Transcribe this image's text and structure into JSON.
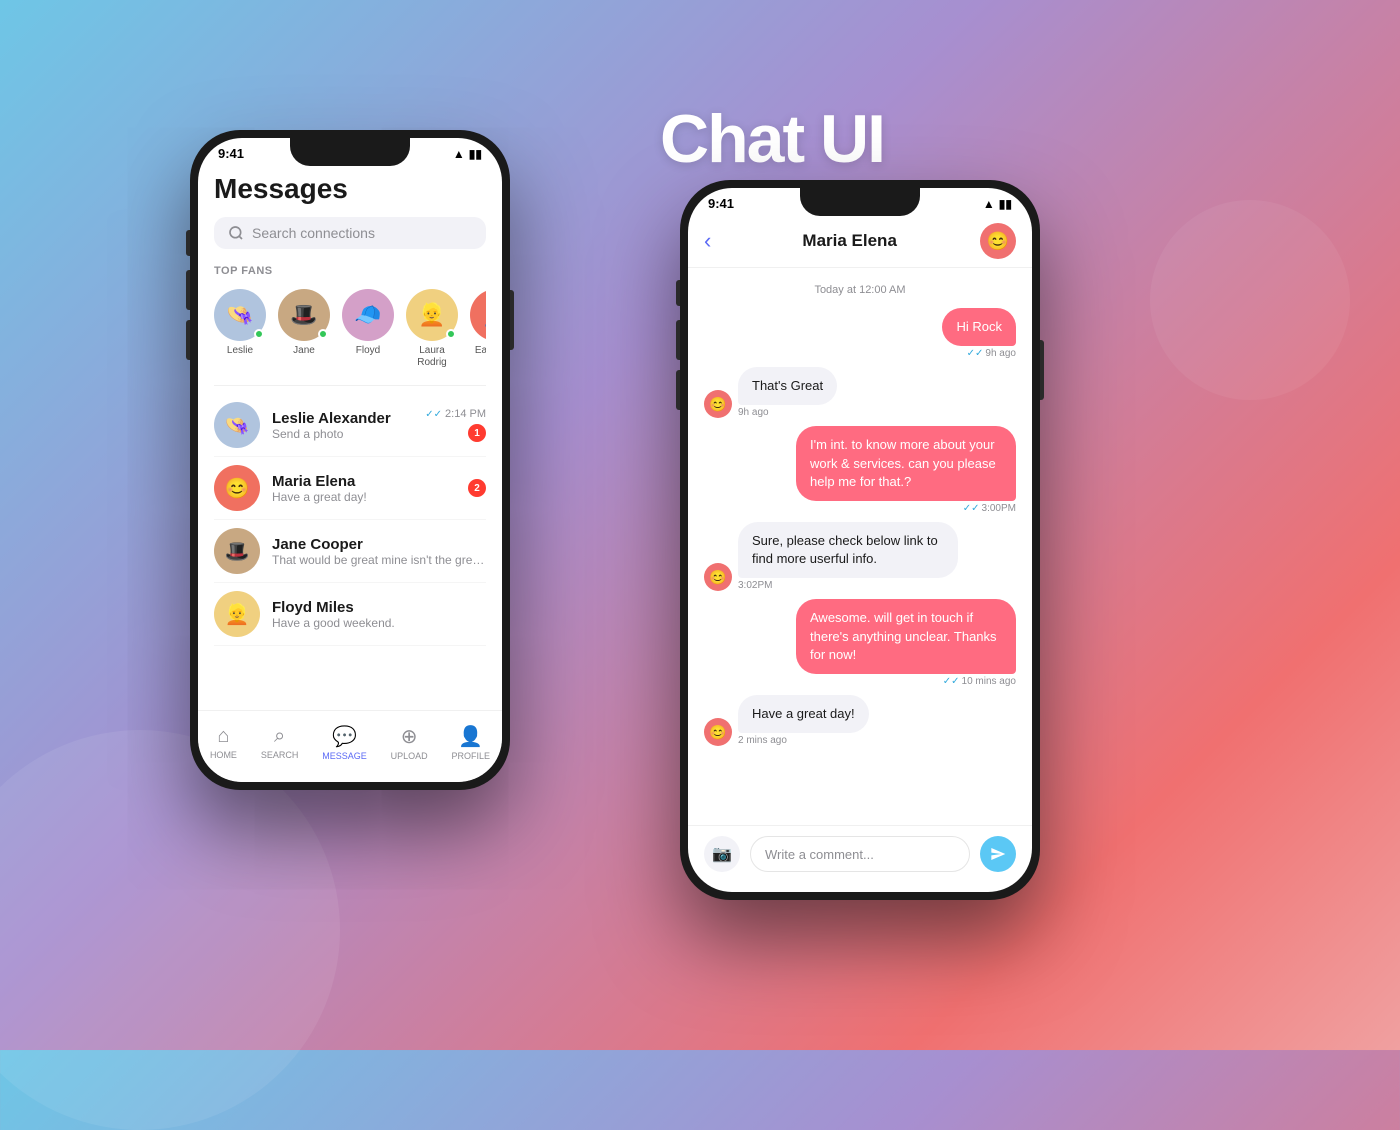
{
  "background": {
    "gradient": "linear-gradient(135deg, #6ec6e6 0%, #a78fd0 40%, #f07070 80%, #f0a0a0 100%)"
  },
  "title": "Chat UI",
  "left_phone": {
    "status_bar": {
      "time": "9:41",
      "wifi": "wifi",
      "battery": "battery"
    },
    "screen_title": "Messages",
    "search_placeholder": "Search connections",
    "section_label": "TOP FANS",
    "fans": [
      {
        "name": "Leslie",
        "emoji": "👒",
        "bg": "#b0c4de",
        "online": true
      },
      {
        "name": "Jane",
        "emoji": "🎩",
        "bg": "#c8a882",
        "online": true
      },
      {
        "name": "Floyd",
        "emoji": "🧢",
        "bg": "#d4a0c8",
        "online": false
      },
      {
        "name": "Laura Rodrig",
        "emoji": "👱",
        "bg": "#f0d080",
        "online": true
      },
      {
        "name": "Earl Mald",
        "emoji": "👤",
        "bg": "#f07060",
        "online": false
      }
    ],
    "conversations": [
      {
        "name": "Leslie Alexander",
        "preview": "Send a photo",
        "time": "2:14 PM",
        "badge": "1",
        "emoji": "👒",
        "bg": "#b0c4de",
        "double_check": true
      },
      {
        "name": "Maria Elena",
        "preview": "Have a great day!",
        "time": "",
        "badge": "2",
        "emoji": "😊",
        "bg": "#f07060",
        "double_check": false
      },
      {
        "name": "Jane Cooper",
        "preview": "That would be great mine isn't the great...",
        "time": "",
        "badge": "",
        "emoji": "🎩",
        "bg": "#c8a882",
        "double_check": false
      },
      {
        "name": "Floyd Miles",
        "preview": "Have a good weekend.",
        "time": "",
        "badge": "",
        "emoji": "👱",
        "bg": "#f0d080",
        "double_check": false
      }
    ],
    "nav_items": [
      {
        "label": "HOME",
        "icon": "⌂",
        "active": false
      },
      {
        "label": "SEARCH",
        "icon": "⌕",
        "active": false
      },
      {
        "label": "MESSAGE",
        "icon": "💬",
        "active": true
      },
      {
        "label": "UPLOAD",
        "icon": "⊕",
        "active": false
      },
      {
        "label": "PROFILE",
        "icon": "👤",
        "active": false
      }
    ]
  },
  "right_phone": {
    "status_bar": {
      "time": "9:41",
      "wifi": "wifi",
      "battery": "battery"
    },
    "contact_name": "Maria Elena",
    "contact_emoji": "😊",
    "messages": [
      {
        "type": "date",
        "text": "Today at 12:00 AM"
      },
      {
        "type": "sent",
        "text": "Hi Rock",
        "time": "9h ago",
        "double_check": true
      },
      {
        "type": "received",
        "text": "That's Great",
        "time": "9h ago",
        "avatar": "😊"
      },
      {
        "type": "sent",
        "text": "I'm int. to know more about your work & services. can you please help me for that.?",
        "time": "3:00PM",
        "double_check": true
      },
      {
        "type": "received",
        "text": "Sure, please check below link to find more userful info.",
        "time": "3:02PM",
        "avatar": "😊"
      },
      {
        "type": "sent",
        "text": "Awesome. will get in touch if there's anything unclear. Thanks for now!",
        "time": "10 mins ago",
        "double_check": true
      },
      {
        "type": "received",
        "text": "Have a great day!",
        "time": "2 mins ago",
        "avatar": "😊"
      }
    ],
    "input_placeholder": "Write a comment..."
  }
}
